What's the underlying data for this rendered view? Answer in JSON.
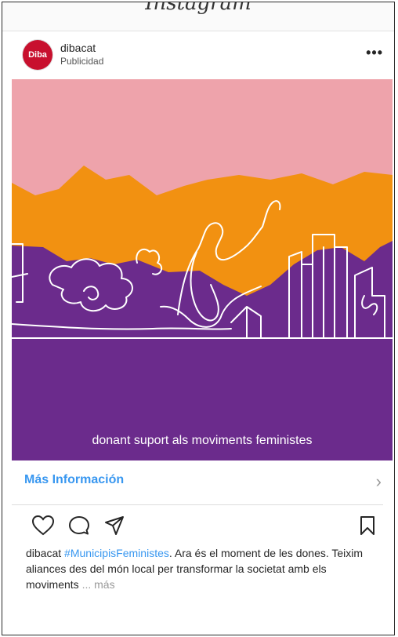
{
  "app": {
    "logo_text": "Instagram"
  },
  "post": {
    "account": "dibacat",
    "avatar_label": "Diba",
    "sponsored_label": "Publicidad",
    "more_label": "•••",
    "hero_tagline": "donant suport als moviments feministes",
    "cta_label": "Más Información",
    "cta_chevron": "›",
    "caption": {
      "user": "dibacat",
      "hashtag": "#MunicipisFeministes",
      "text": ". Ara és el moment de les dones. Teixim aliances des del món local per transformar la societat amb els moviments",
      "ellipsis": " ...",
      "more": " más"
    }
  },
  "colors": {
    "brand_red": "#c8102e",
    "link_blue": "#3897f0",
    "hero_pink": "#eea3ab",
    "hero_orange": "#f29111",
    "hero_purple": "#6b2b8c"
  }
}
